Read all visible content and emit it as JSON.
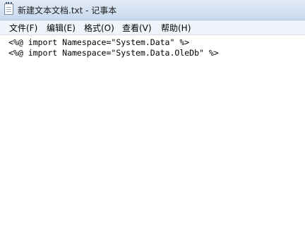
{
  "window": {
    "title": "新建文本文档.txt - 记事本",
    "icon": "notepad-icon"
  },
  "menu": {
    "items": [
      {
        "label": "文件(F)"
      },
      {
        "label": "编辑(E)"
      },
      {
        "label": "格式(O)"
      },
      {
        "label": "查看(V)"
      },
      {
        "label": "帮助(H)"
      }
    ]
  },
  "editor": {
    "lines": [
      "<%@ import Namespace=\"System.Data\" %>",
      "<%@ import Namespace=\"System.Data.OleDb\" %>"
    ]
  }
}
